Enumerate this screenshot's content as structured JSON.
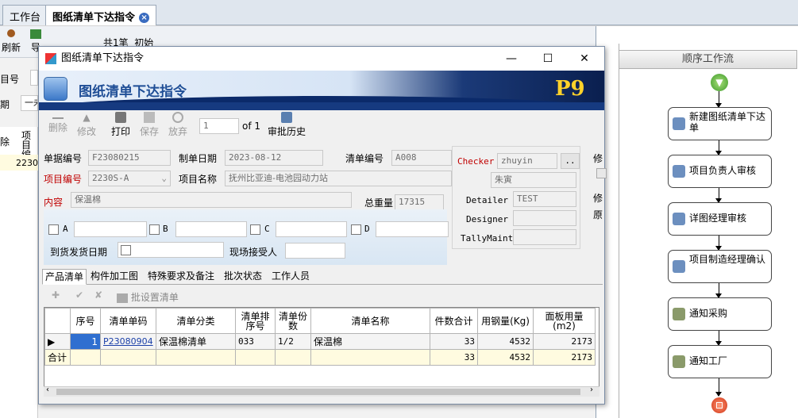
{
  "tabs": [
    {
      "label": "工作台"
    },
    {
      "label": "图纸清单下达指令"
    }
  ],
  "bg": {
    "refresh": "刷新",
    "export": "导",
    "count": "共1笔",
    "state": "初始",
    "proj_label": "目号",
    "date_label": "期",
    "date_val": "一未",
    "col_del": "除",
    "col_proj": "项目编号",
    "row_val": "2230"
  },
  "dialog": {
    "title": "图纸清单下达指令",
    "banner_title": "图纸清单下达指令",
    "brand": "P9",
    "toolbar": {
      "delete": "删除",
      "edit": "修改",
      "print": "打印",
      "save": "保存",
      "abandon": "放弃",
      "page": "1",
      "of": "of 1",
      "history": "审批历史"
    },
    "form": {
      "no_label": "单据编号",
      "no": "F23080215",
      "date_label": "制单日期",
      "date": "2023-08-12",
      "list_label": "清单编号",
      "list": "A008",
      "proj_label": "项目编号",
      "proj": "2230S-A",
      "name_label": "项目名称",
      "name": "抚州比亚迪-电池园动力站",
      "content_label": "内容",
      "content": "保温棉",
      "weight_label": "总重量",
      "weight": "17315",
      "a": "A",
      "b": "B",
      "c": "C",
      "d": "D",
      "arrive_label": "到货发货日期",
      "recv_label": "现场接受人",
      "checker_label": "Checker",
      "checker": "zhuyin",
      "checker_btn": "..",
      "checker_name": "朱寅",
      "detailer_label": "Detailer",
      "detailer": "TEST",
      "designer_label": "Designer",
      "tally_label": "TallyMaint",
      "cut1": "修",
      "cut2": "修",
      "cut3": "原"
    },
    "subtabs": [
      "产品清单",
      "构件加工图",
      "特殊要求及备注",
      "批次状态",
      "工作人员"
    ],
    "grid_tool": {
      "batch": "批设置清单"
    },
    "grid": {
      "headers": [
        "序号",
        "清单单码",
        "清单分类",
        "清单排序号",
        "清单份数",
        "清单名称",
        "件数合计",
        "用钢量(Kg)",
        "面板用量(m2)"
      ],
      "row": [
        "1",
        "P23080904",
        "保温棉清单",
        "033",
        "1/2",
        "保温棉",
        "33",
        "4532",
        "2173"
      ],
      "total_label": "合计",
      "total": [
        "33",
        "4532",
        "2173"
      ]
    }
  },
  "workflow": {
    "title": "顺序工作流",
    "nodes": [
      "新建图纸清单下达单",
      "项目负责人审核",
      "详图经理审核",
      "项目制造经理确认",
      "通知采购",
      "通知工厂"
    ]
  }
}
